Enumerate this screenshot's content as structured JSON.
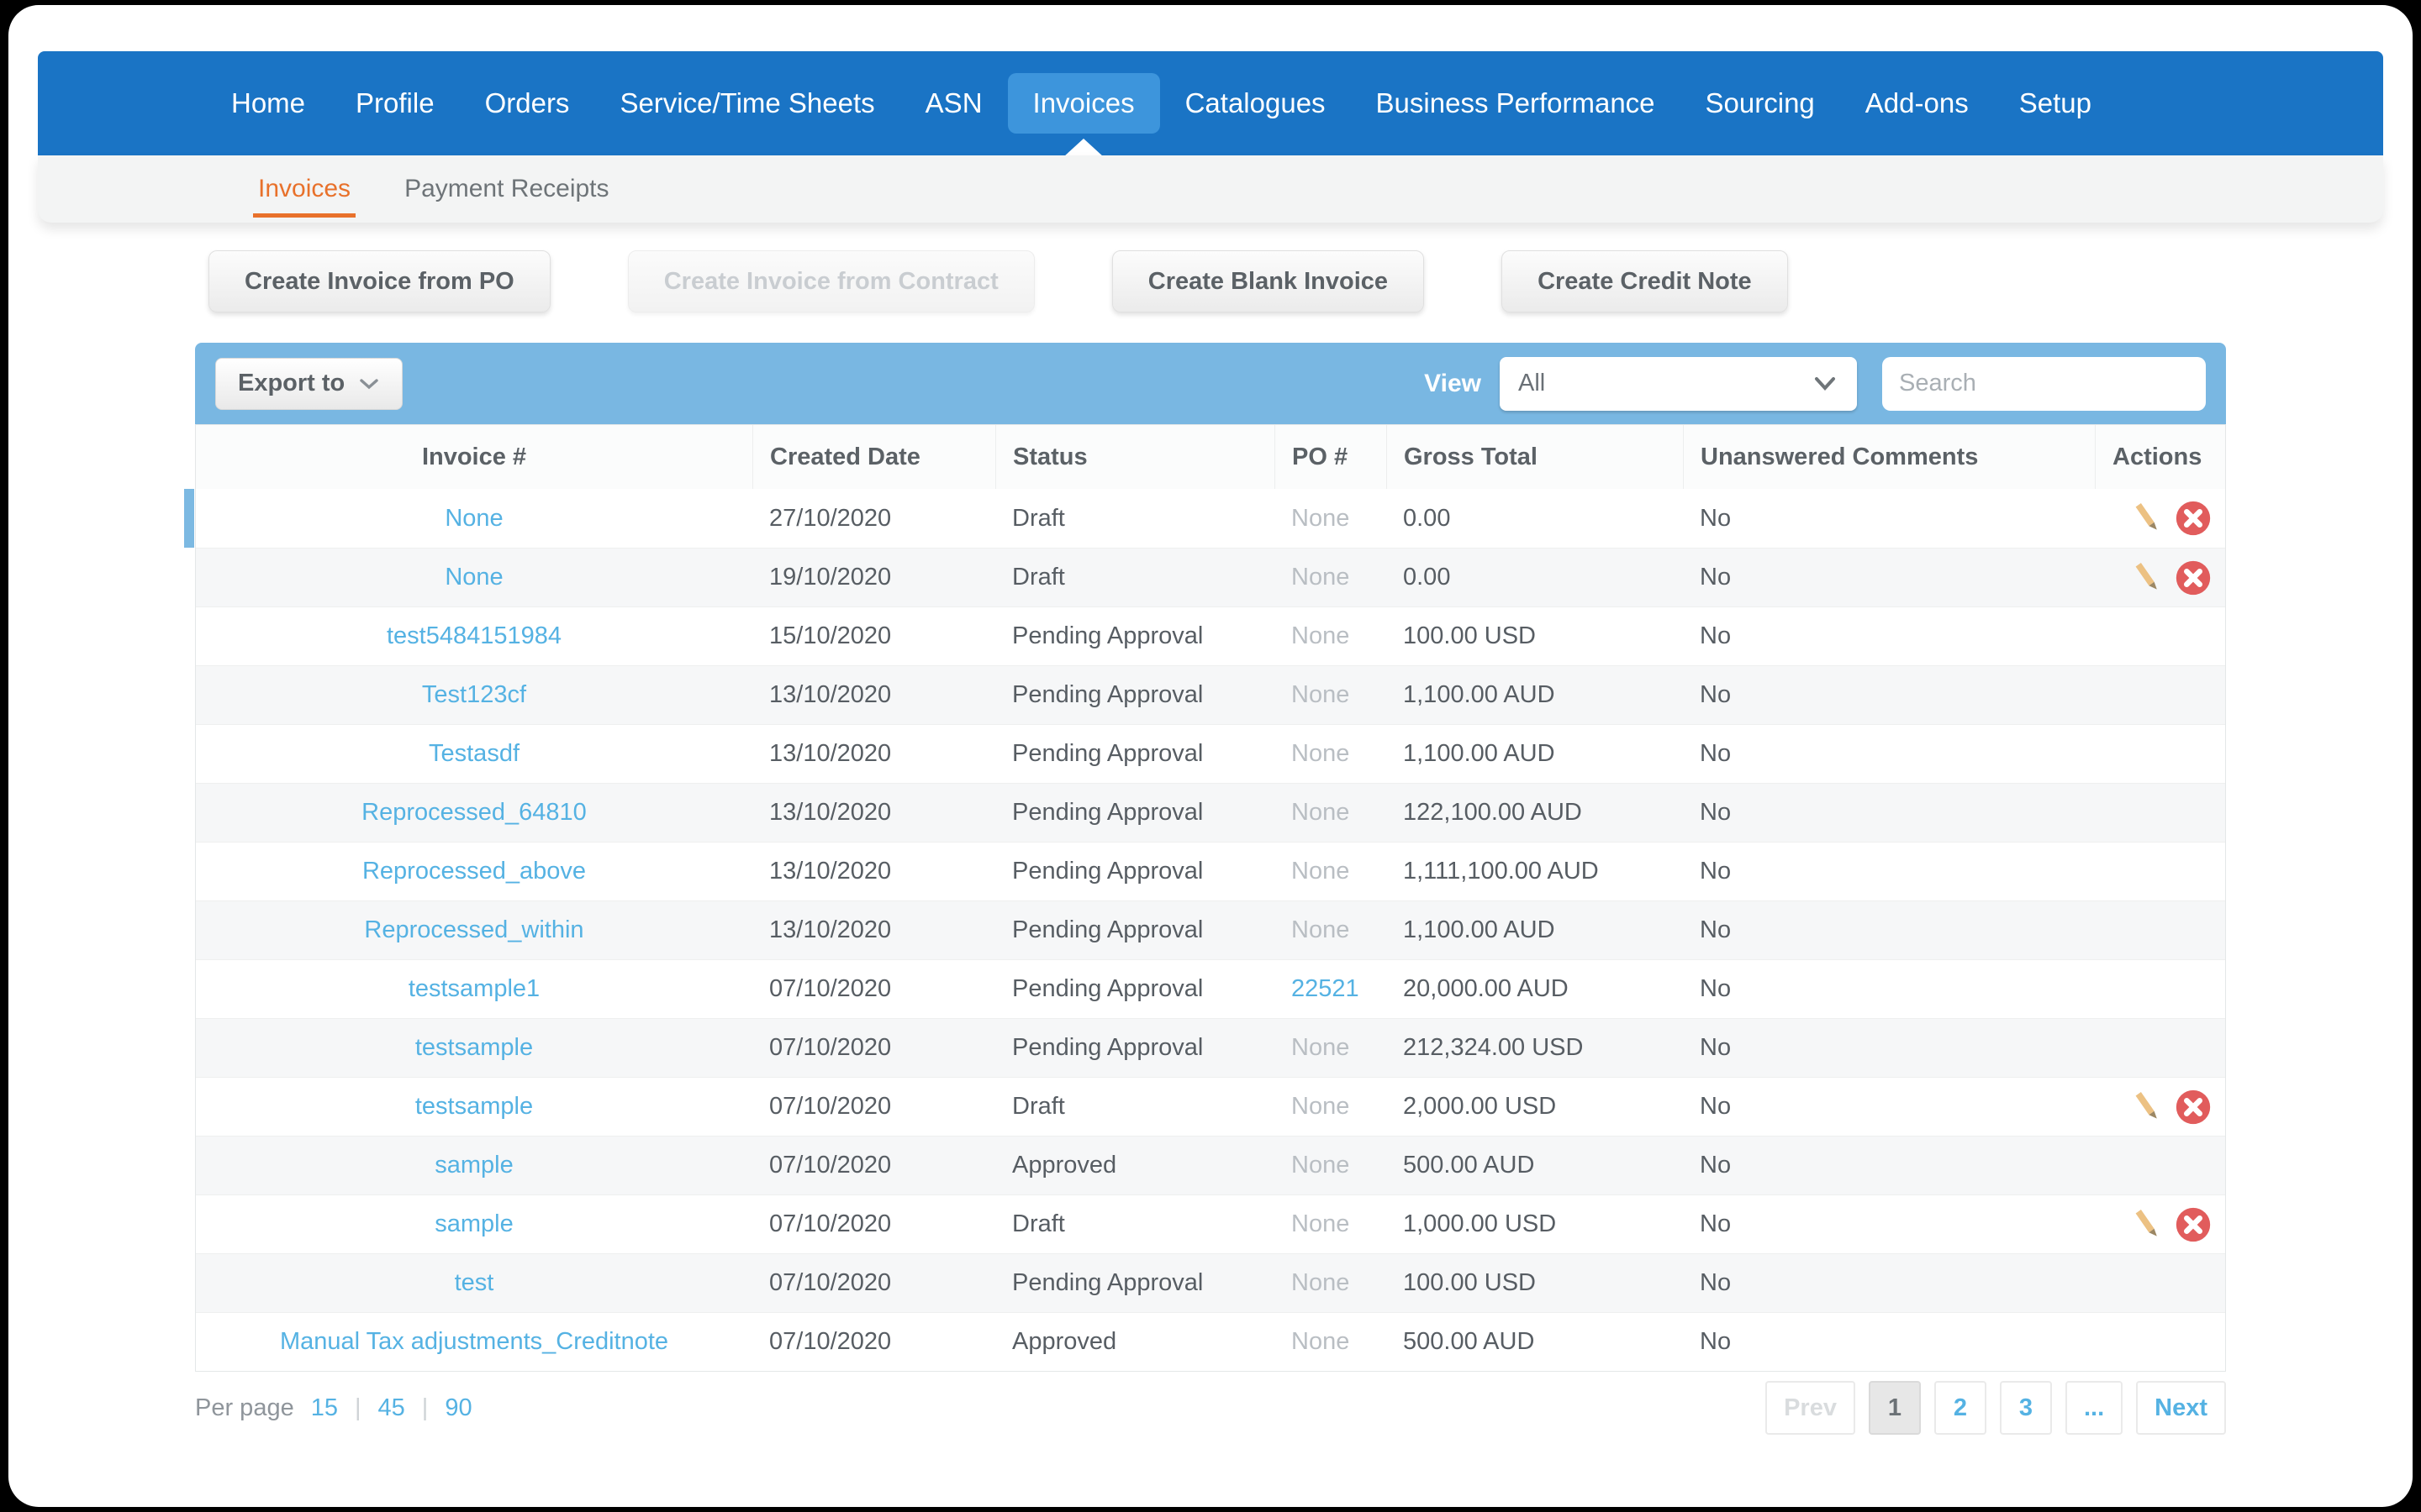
{
  "nav": {
    "items": [
      {
        "label": "Home",
        "active": false
      },
      {
        "label": "Profile",
        "active": false
      },
      {
        "label": "Orders",
        "active": false
      },
      {
        "label": "Service/Time Sheets",
        "active": false
      },
      {
        "label": "ASN",
        "active": false
      },
      {
        "label": "Invoices",
        "active": true
      },
      {
        "label": "Catalogues",
        "active": false
      },
      {
        "label": "Business Performance",
        "active": false
      },
      {
        "label": "Sourcing",
        "active": false
      },
      {
        "label": "Add-ons",
        "active": false
      },
      {
        "label": "Setup",
        "active": false
      }
    ]
  },
  "subnav": {
    "tabs": [
      {
        "label": "Invoices",
        "active": true
      },
      {
        "label": "Payment Receipts",
        "active": false
      }
    ]
  },
  "create_buttons": [
    {
      "label": "Create Invoice from PO",
      "disabled": false
    },
    {
      "label": "Create Invoice from Contract",
      "disabled": true
    },
    {
      "label": "Create Blank Invoice",
      "disabled": false
    },
    {
      "label": "Create Credit Note",
      "disabled": false
    }
  ],
  "toolbar": {
    "export_label": "Export to",
    "view_label": "View",
    "view_value": "All",
    "search_placeholder": "Search"
  },
  "table": {
    "columns": [
      "Invoice #",
      "Created Date",
      "Status",
      "PO #",
      "Gross Total",
      "Unanswered Comments",
      "Actions"
    ],
    "rows": [
      {
        "invoice": "None",
        "created": "27/10/2020",
        "status": "Draft",
        "po": "None",
        "po_is_link": false,
        "gross": "0.00",
        "comments": "No",
        "actions": true,
        "selected": true
      },
      {
        "invoice": "None",
        "created": "19/10/2020",
        "status": "Draft",
        "po": "None",
        "po_is_link": false,
        "gross": "0.00",
        "comments": "No",
        "actions": true,
        "selected": false
      },
      {
        "invoice": "test5484151984",
        "created": "15/10/2020",
        "status": "Pending Approval",
        "po": "None",
        "po_is_link": false,
        "gross": "100.00 USD",
        "comments": "No",
        "actions": false,
        "selected": false
      },
      {
        "invoice": "Test123cf",
        "created": "13/10/2020",
        "status": "Pending Approval",
        "po": "None",
        "po_is_link": false,
        "gross": "1,100.00 AUD",
        "comments": "No",
        "actions": false,
        "selected": false
      },
      {
        "invoice": "Testasdf",
        "created": "13/10/2020",
        "status": "Pending Approval",
        "po": "None",
        "po_is_link": false,
        "gross": "1,100.00 AUD",
        "comments": "No",
        "actions": false,
        "selected": false
      },
      {
        "invoice": "Reprocessed_64810",
        "created": "13/10/2020",
        "status": "Pending Approval",
        "po": "None",
        "po_is_link": false,
        "gross": "122,100.00 AUD",
        "comments": "No",
        "actions": false,
        "selected": false
      },
      {
        "invoice": "Reprocessed_above",
        "created": "13/10/2020",
        "status": "Pending Approval",
        "po": "None",
        "po_is_link": false,
        "gross": "1,111,100.00 AUD",
        "comments": "No",
        "actions": false,
        "selected": false
      },
      {
        "invoice": "Reprocessed_within",
        "created": "13/10/2020",
        "status": "Pending Approval",
        "po": "None",
        "po_is_link": false,
        "gross": "1,100.00 AUD",
        "comments": "No",
        "actions": false,
        "selected": false
      },
      {
        "invoice": "testsample1",
        "created": "07/10/2020",
        "status": "Pending Approval",
        "po": "22521",
        "po_is_link": true,
        "gross": "20,000.00 AUD",
        "comments": "No",
        "actions": false,
        "selected": false
      },
      {
        "invoice": "testsample",
        "created": "07/10/2020",
        "status": "Pending Approval",
        "po": "None",
        "po_is_link": false,
        "gross": "212,324.00 USD",
        "comments": "No",
        "actions": false,
        "selected": false
      },
      {
        "invoice": "testsample",
        "created": "07/10/2020",
        "status": "Draft",
        "po": "None",
        "po_is_link": false,
        "gross": "2,000.00 USD",
        "comments": "No",
        "actions": true,
        "selected": false
      },
      {
        "invoice": "sample",
        "created": "07/10/2020",
        "status": "Approved",
        "po": "None",
        "po_is_link": false,
        "gross": "500.00 AUD",
        "comments": "No",
        "actions": false,
        "selected": false
      },
      {
        "invoice": "sample",
        "created": "07/10/2020",
        "status": "Draft",
        "po": "None",
        "po_is_link": false,
        "gross": "1,000.00 USD",
        "comments": "No",
        "actions": true,
        "selected": false
      },
      {
        "invoice": "test",
        "created": "07/10/2020",
        "status": "Pending Approval",
        "po": "None",
        "po_is_link": false,
        "gross": "100.00 USD",
        "comments": "No",
        "actions": false,
        "selected": false
      },
      {
        "invoice": "Manual Tax adjustments_Creditnote",
        "created": "07/10/2020",
        "status": "Approved",
        "po": "None",
        "po_is_link": false,
        "gross": "500.00 AUD",
        "comments": "No",
        "actions": false,
        "selected": false
      }
    ]
  },
  "pagination": {
    "per_page_label": "Per page",
    "per_page_options": [
      "15",
      "45",
      "90"
    ],
    "separator": "|",
    "pages": [
      {
        "label": "Prev",
        "disabled": true,
        "active": false
      },
      {
        "label": "1",
        "disabled": false,
        "active": true
      },
      {
        "label": "2",
        "disabled": false,
        "active": false
      },
      {
        "label": "3",
        "disabled": false,
        "active": false
      },
      {
        "label": "...",
        "disabled": false,
        "active": false
      },
      {
        "label": "Next",
        "disabled": false,
        "active": false
      }
    ]
  },
  "icons": {
    "edit": "pencil-icon",
    "delete": "delete-x-icon",
    "search": "search-icon",
    "chevron": "chevron-down-icon"
  },
  "colors": {
    "nav_blue": "#1a74c5",
    "nav_active": "#3d95dc",
    "toolbar_blue": "#79b7e2",
    "link_blue": "#55b2e3",
    "accent_orange": "#e8712b",
    "row_alt": "#f6f7f8",
    "danger_red": "#e15c5c",
    "pencil_tan": "#ecc183"
  }
}
